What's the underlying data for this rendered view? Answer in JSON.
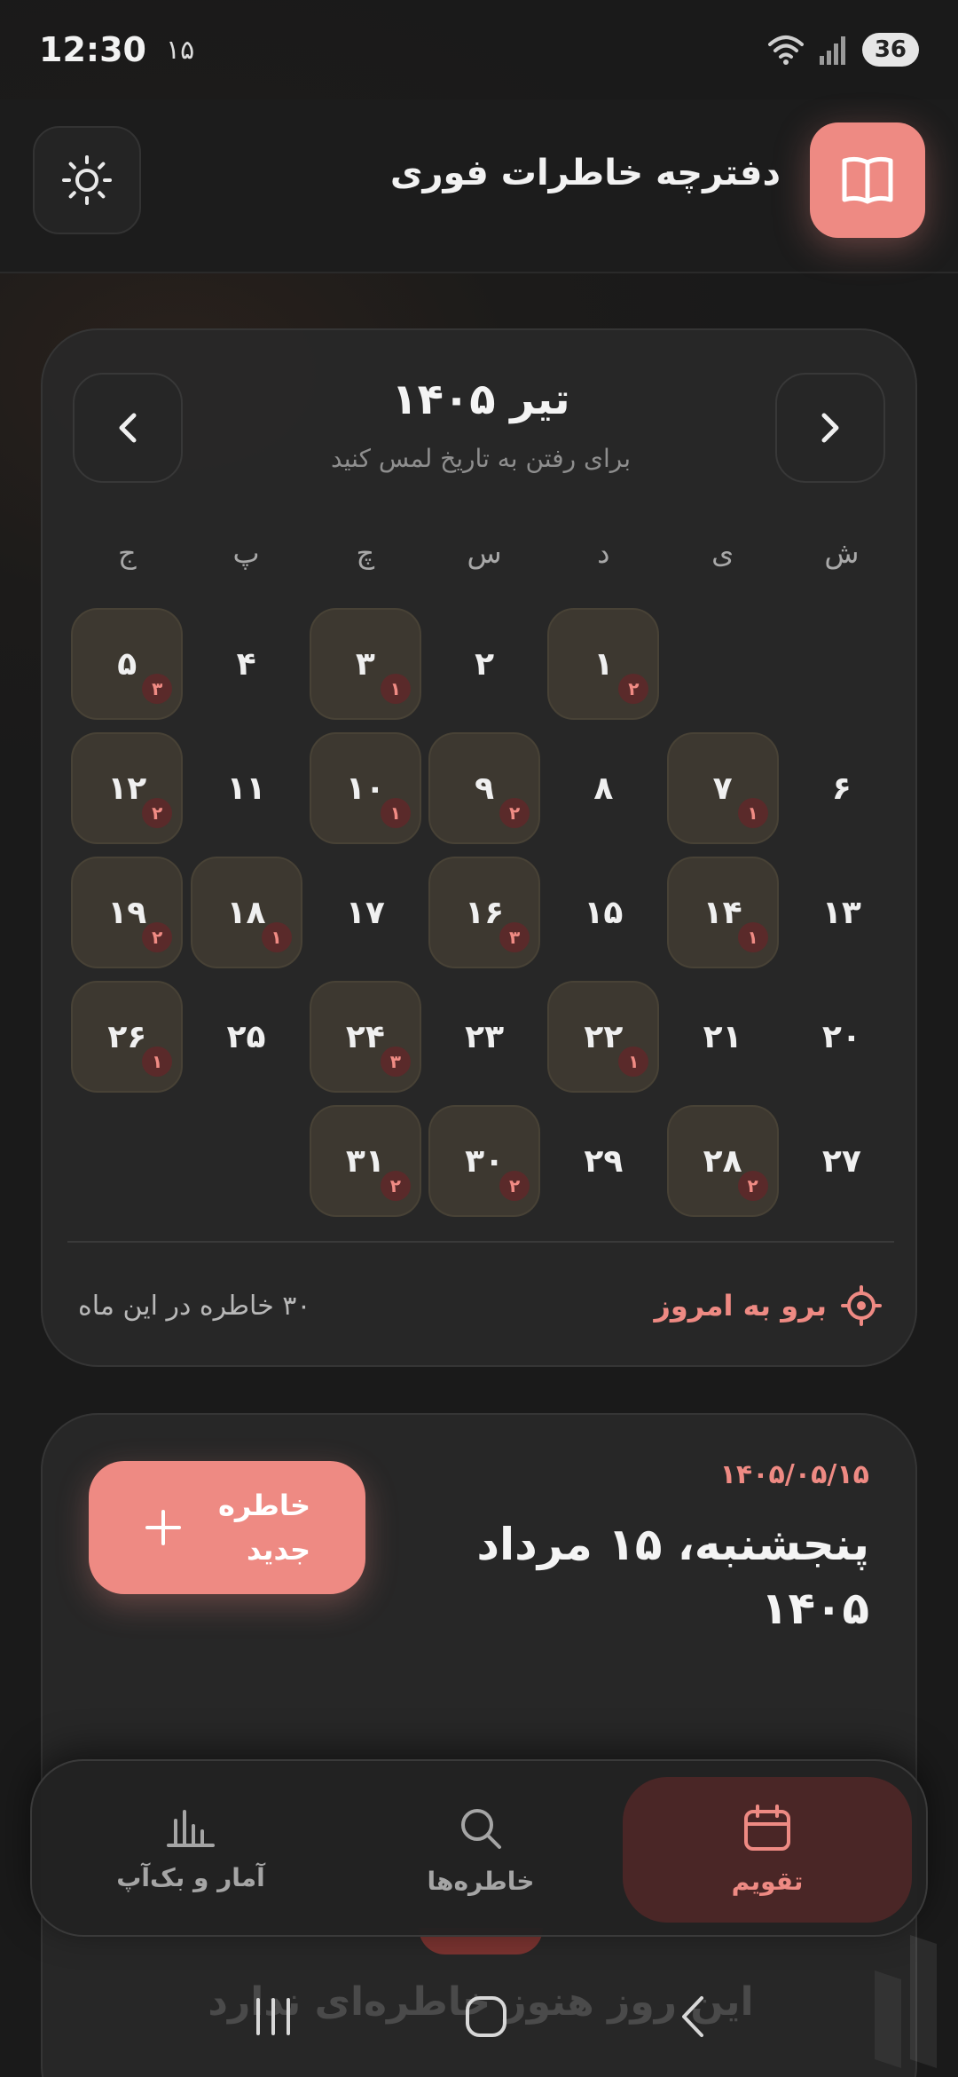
{
  "status": {
    "time": "12:30",
    "date": "۱۵",
    "battery": "36"
  },
  "header": {
    "title": "دفترچه خاطرات فوری",
    "theme_icon": "sun-icon",
    "logo_icon": "book-icon"
  },
  "calendar": {
    "month_title": "تیر ۱۴۰۵",
    "hint": "برای رفتن به تاریخ لمس کنید",
    "weekdays": [
      "ش",
      "ی",
      "د",
      "س",
      "چ",
      "پ",
      "ج"
    ],
    "leading_blanks": 2,
    "days": [
      {
        "d": "۱",
        "count": "۲"
      },
      {
        "d": "۲",
        "count": ""
      },
      {
        "d": "۳",
        "count": "۱"
      },
      {
        "d": "۴",
        "count": ""
      },
      {
        "d": "۵",
        "count": "۳"
      },
      {
        "d": "۶",
        "count": ""
      },
      {
        "d": "۷",
        "count": "۱"
      },
      {
        "d": "۸",
        "count": ""
      },
      {
        "d": "۹",
        "count": "۲"
      },
      {
        "d": "۱۰",
        "count": "۱"
      },
      {
        "d": "۱۱",
        "count": ""
      },
      {
        "d": "۱۲",
        "count": "۲"
      },
      {
        "d": "۱۳",
        "count": ""
      },
      {
        "d": "۱۴",
        "count": "۱"
      },
      {
        "d": "۱۵",
        "count": ""
      },
      {
        "d": "۱۶",
        "count": "۳"
      },
      {
        "d": "۱۷",
        "count": ""
      },
      {
        "d": "۱۸",
        "count": "۱"
      },
      {
        "d": "۱۹",
        "count": "۲"
      },
      {
        "d": "۲۰",
        "count": ""
      },
      {
        "d": "۲۱",
        "count": ""
      },
      {
        "d": "۲۲",
        "count": "۱"
      },
      {
        "d": "۲۳",
        "count": ""
      },
      {
        "d": "۲۴",
        "count": "۳"
      },
      {
        "d": "۲۵",
        "count": ""
      },
      {
        "d": "۲۶",
        "count": "۱"
      },
      {
        "d": "۲۷",
        "count": ""
      },
      {
        "d": "۲۸",
        "count": "۲"
      },
      {
        "d": "۲۹",
        "count": ""
      },
      {
        "d": "۳۰",
        "count": "۲"
      },
      {
        "d": "۳۱",
        "count": "۲"
      }
    ],
    "count_label": "۳۰ خاطره در این ماه",
    "today_label": "برو به امروز"
  },
  "day": {
    "date": "۱۴۰۵/۰۵/۱۵",
    "title": "پنجشنبه، ۱۵ مرداد ۱۴۰۵",
    "new_memory_label": "خاطره جدید",
    "empty_title": "این روز هنوز خاطره‌ای ندارد"
  },
  "bottom_nav": {
    "calendar": "تقویم",
    "memories": "خاطره‌ها",
    "stats": "آمار و بک‌آپ"
  },
  "colors": {
    "accent": "#ee8a83",
    "background": "#1b1b1b",
    "card": "#282828",
    "day_marked": "#3d3830"
  }
}
